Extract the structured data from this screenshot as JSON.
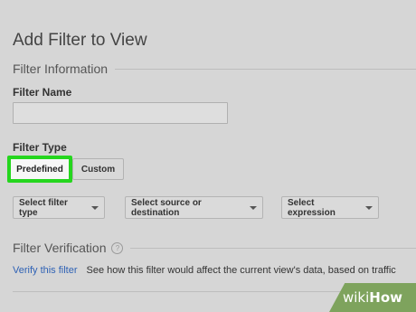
{
  "page": {
    "title": "Add Filter to View"
  },
  "filter_information": {
    "header": "Filter Information",
    "name_label": "Filter Name",
    "name_value": "",
    "type_label": "Filter Type",
    "type_options": {
      "predefined": "Predefined",
      "custom": "Custom"
    },
    "selected_type": "Predefined",
    "dropdowns": {
      "filter_type": "Select filter type",
      "source_destination": "Select source or destination",
      "expression": "Select expression"
    }
  },
  "filter_verification": {
    "header": "Filter Verification",
    "help_icon": "?",
    "link_text": "Verify this filter",
    "description": "See how this filter would affect the current view's data, based on traffic"
  },
  "watermark": {
    "part1": "wiki",
    "part2": "How"
  },
  "colors": {
    "highlight": "#25d61e",
    "link": "#2f62b5",
    "watermark": "#7ea35d"
  }
}
